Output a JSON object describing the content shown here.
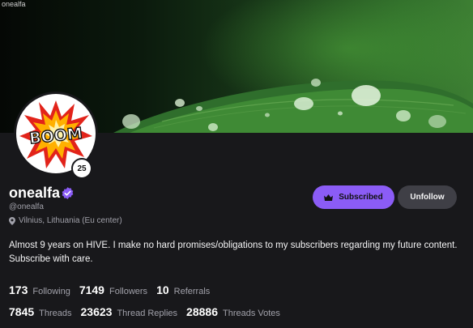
{
  "banner": {
    "alt_text": "onealfa"
  },
  "profile": {
    "avatar_text": "BOOM",
    "level": "25",
    "username": "onealfa",
    "handle": "@onealfa",
    "location": "Vilnius, Lithuania (Eu center)",
    "bio": "Almost 9 years on HIVE. I make no hard promises/obligations to my subscribers regarding my future content. Subscribe with care."
  },
  "actions": {
    "subscribed_label": "Subscribed",
    "unfollow_label": "Unfollow"
  },
  "stats": {
    "following": {
      "value": "173",
      "label": "Following"
    },
    "followers": {
      "value": "7149",
      "label": "Followers"
    },
    "referrals": {
      "value": "10",
      "label": "Referrals"
    },
    "threads": {
      "value": "7845",
      "label": "Threads"
    },
    "thread_replies": {
      "value": "23623",
      "label": "Thread Replies"
    },
    "threads_votes": {
      "value": "28886",
      "label": "Threads Votes"
    }
  },
  "colors": {
    "background": "#18181b",
    "accent": "#8b5cf6",
    "secondary_button": "#3f3f46",
    "muted_text": "#a1a1aa"
  },
  "icons": [
    "verified-badge-icon",
    "location-pin-icon",
    "crown-icon"
  ]
}
